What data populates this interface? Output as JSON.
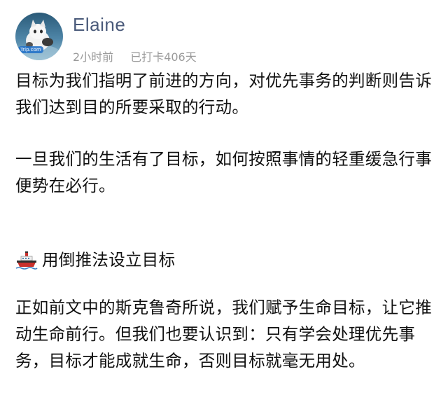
{
  "post": {
    "author": {
      "name": "Elaine",
      "avatar_badge": "Trip.com",
      "avatar_icon": "cat-avatar"
    },
    "meta": {
      "time": "2小时前",
      "checkin": "已打卡406天"
    },
    "paragraphs": [
      "目标为我们指明了前进的方向，对优先事务的判断则告诉我们达到目的所要采取的行动。",
      "一旦我们的生活有了目标，如何按照事情的轻重缓急行事便势在必行。"
    ],
    "section": {
      "icon": "ship-icon",
      "title": "用倒推法设立目标"
    },
    "body": "正如前文中的斯克鲁奇所说，我们赋予生命目标，让它推动生命前行。但我们也要认识到：只有学会处理优先事务，目标才能成就生命，否则目标就毫无用处。"
  },
  "colors": {
    "author_name": "#4a5a7a",
    "meta_text": "#9a9a9a",
    "body_text": "#111111"
  }
}
